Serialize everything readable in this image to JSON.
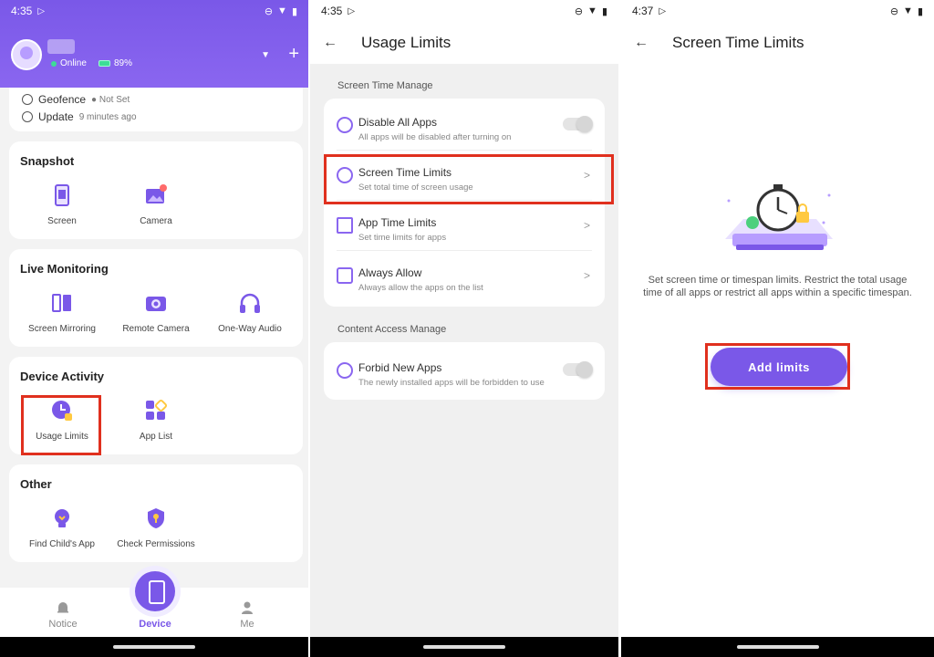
{
  "colors": {
    "accent": "#7a58e8",
    "highlight": "#e0301e",
    "online": "#3ddc97"
  },
  "panel1": {
    "status_time": "4:35",
    "status_icons": [
      "play-store-icon",
      "dnd-icon",
      "wifi-icon",
      "battery-icon"
    ],
    "header": {
      "online": "Online",
      "battery": "89%"
    },
    "geofence": {
      "label": "Geofence",
      "value": "Not Set"
    },
    "update": {
      "label": "Update",
      "value": "9 minutes ago"
    },
    "snapshot": {
      "title": "Snapshot",
      "items": [
        {
          "label": "Screen"
        },
        {
          "label": "Camera"
        }
      ]
    },
    "live": {
      "title": "Live Monitoring",
      "items": [
        {
          "label": "Screen Mirroring"
        },
        {
          "label": "Remote Camera"
        },
        {
          "label": "One-Way Audio"
        }
      ]
    },
    "activity": {
      "title": "Device Activity",
      "items": [
        {
          "label": "Usage Limits"
        },
        {
          "label": "App List"
        }
      ]
    },
    "other": {
      "title": "Other",
      "items": [
        {
          "label": "Find Child's App"
        },
        {
          "label": "Check Permissions"
        }
      ]
    },
    "tabs": [
      {
        "label": "Notice"
      },
      {
        "label": "Device"
      },
      {
        "label": "Me"
      }
    ],
    "active_tab": "Device"
  },
  "panel2": {
    "status_time": "4:35",
    "title": "Usage Limits",
    "section1": "Screen Time Manage",
    "rows1": [
      {
        "title": "Disable All Apps",
        "sub": "All apps will be disabled after turning on",
        "control": "toggle-off"
      },
      {
        "title": "Screen Time Limits",
        "sub": "Set total time of screen usage",
        "control": "chevron"
      },
      {
        "title": "App Time Limits",
        "sub": "Set time limits for apps",
        "control": "chevron"
      },
      {
        "title": "Always Allow",
        "sub": "Always allow the apps on the list",
        "control": "chevron"
      }
    ],
    "section2": "Content Access Manage",
    "rows2": [
      {
        "title": "Forbid New Apps",
        "sub": "The newly installed apps will be forbidden to use",
        "control": "toggle-off"
      }
    ]
  },
  "panel3": {
    "status_time": "4:37",
    "title": "Screen Time Limits",
    "description": "Set screen time or timespan limits. Restrict the total usage time of all apps or restrict all apps within a specific timespan.",
    "button": "Add limits"
  }
}
